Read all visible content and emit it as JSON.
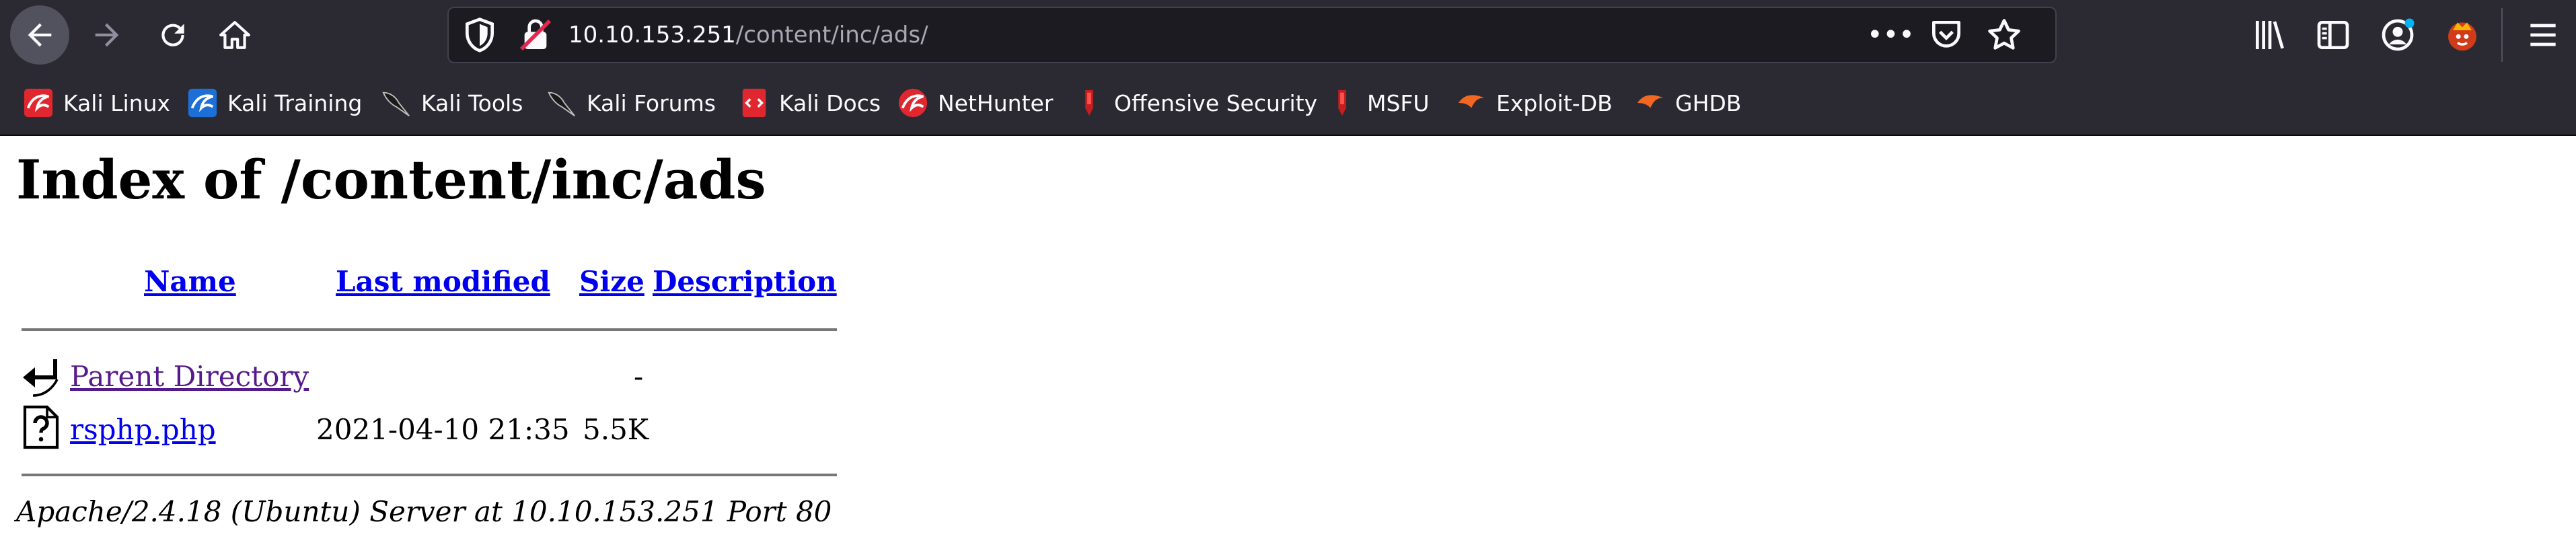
{
  "browser": {
    "url_host": "10.10.153.251",
    "url_path": "/content/inc/ads/",
    "more_label": "•••",
    "icons": {
      "back": "back-arrow-icon",
      "forward": "forward-arrow-icon",
      "reload": "reload-icon",
      "home": "home-icon",
      "shield": "tracking-protection-shield-icon",
      "lock": "insecure-lock-icon",
      "pocket": "pocket-icon",
      "star": "bookmark-star-icon",
      "library": "library-icon",
      "sidebar": "sidebar-icon",
      "account": "account-icon",
      "extension": "extension-icon",
      "menu": "hamburger-menu-icon"
    }
  },
  "bookmarks": [
    {
      "label": "Kali Linux",
      "icon": "kali-dragon-icon"
    },
    {
      "label": "Kali Training",
      "icon": "kali-training-icon"
    },
    {
      "label": "Kali Tools",
      "icon": "kali-dragon-icon"
    },
    {
      "label": "Kali Forums",
      "icon": "kali-dragon-icon"
    },
    {
      "label": "Kali Docs",
      "icon": "kali-docs-icon"
    },
    {
      "label": "NetHunter",
      "icon": "nethunter-icon"
    },
    {
      "label": "Offensive Security",
      "icon": "offsec-icon"
    },
    {
      "label": "MSFU",
      "icon": "offsec-icon"
    },
    {
      "label": "Exploit-DB",
      "icon": "exploit-db-icon"
    },
    {
      "label": "GHDB",
      "icon": "exploit-db-icon"
    }
  ],
  "listing": {
    "title": "Index of /content/inc/ads",
    "headers": {
      "name": "Name",
      "last_modified": "Last modified",
      "size": "Size",
      "description": "Description"
    },
    "rows": [
      {
        "name": "Parent Directory",
        "modified": "",
        "size": "-",
        "icon": "back-folder-icon",
        "visited": true
      },
      {
        "name": "rsphp.php",
        "modified": "2021-04-10 21:35",
        "size": "5.5K",
        "icon": "unknown-file-icon",
        "visited": false
      }
    ],
    "address": "Apache/2.4.18 (Ubuntu) Server at 10.10.153.251 Port 80"
  },
  "colors": {
    "chrome_bg": "#2b2a33",
    "urlbar_bg": "#1c1b22",
    "link": "#0000ee",
    "visited_link": "#551a8b",
    "kali_red": "#e0262f",
    "exploit_orange": "#f26822",
    "account_badge": "#00b3f4"
  }
}
